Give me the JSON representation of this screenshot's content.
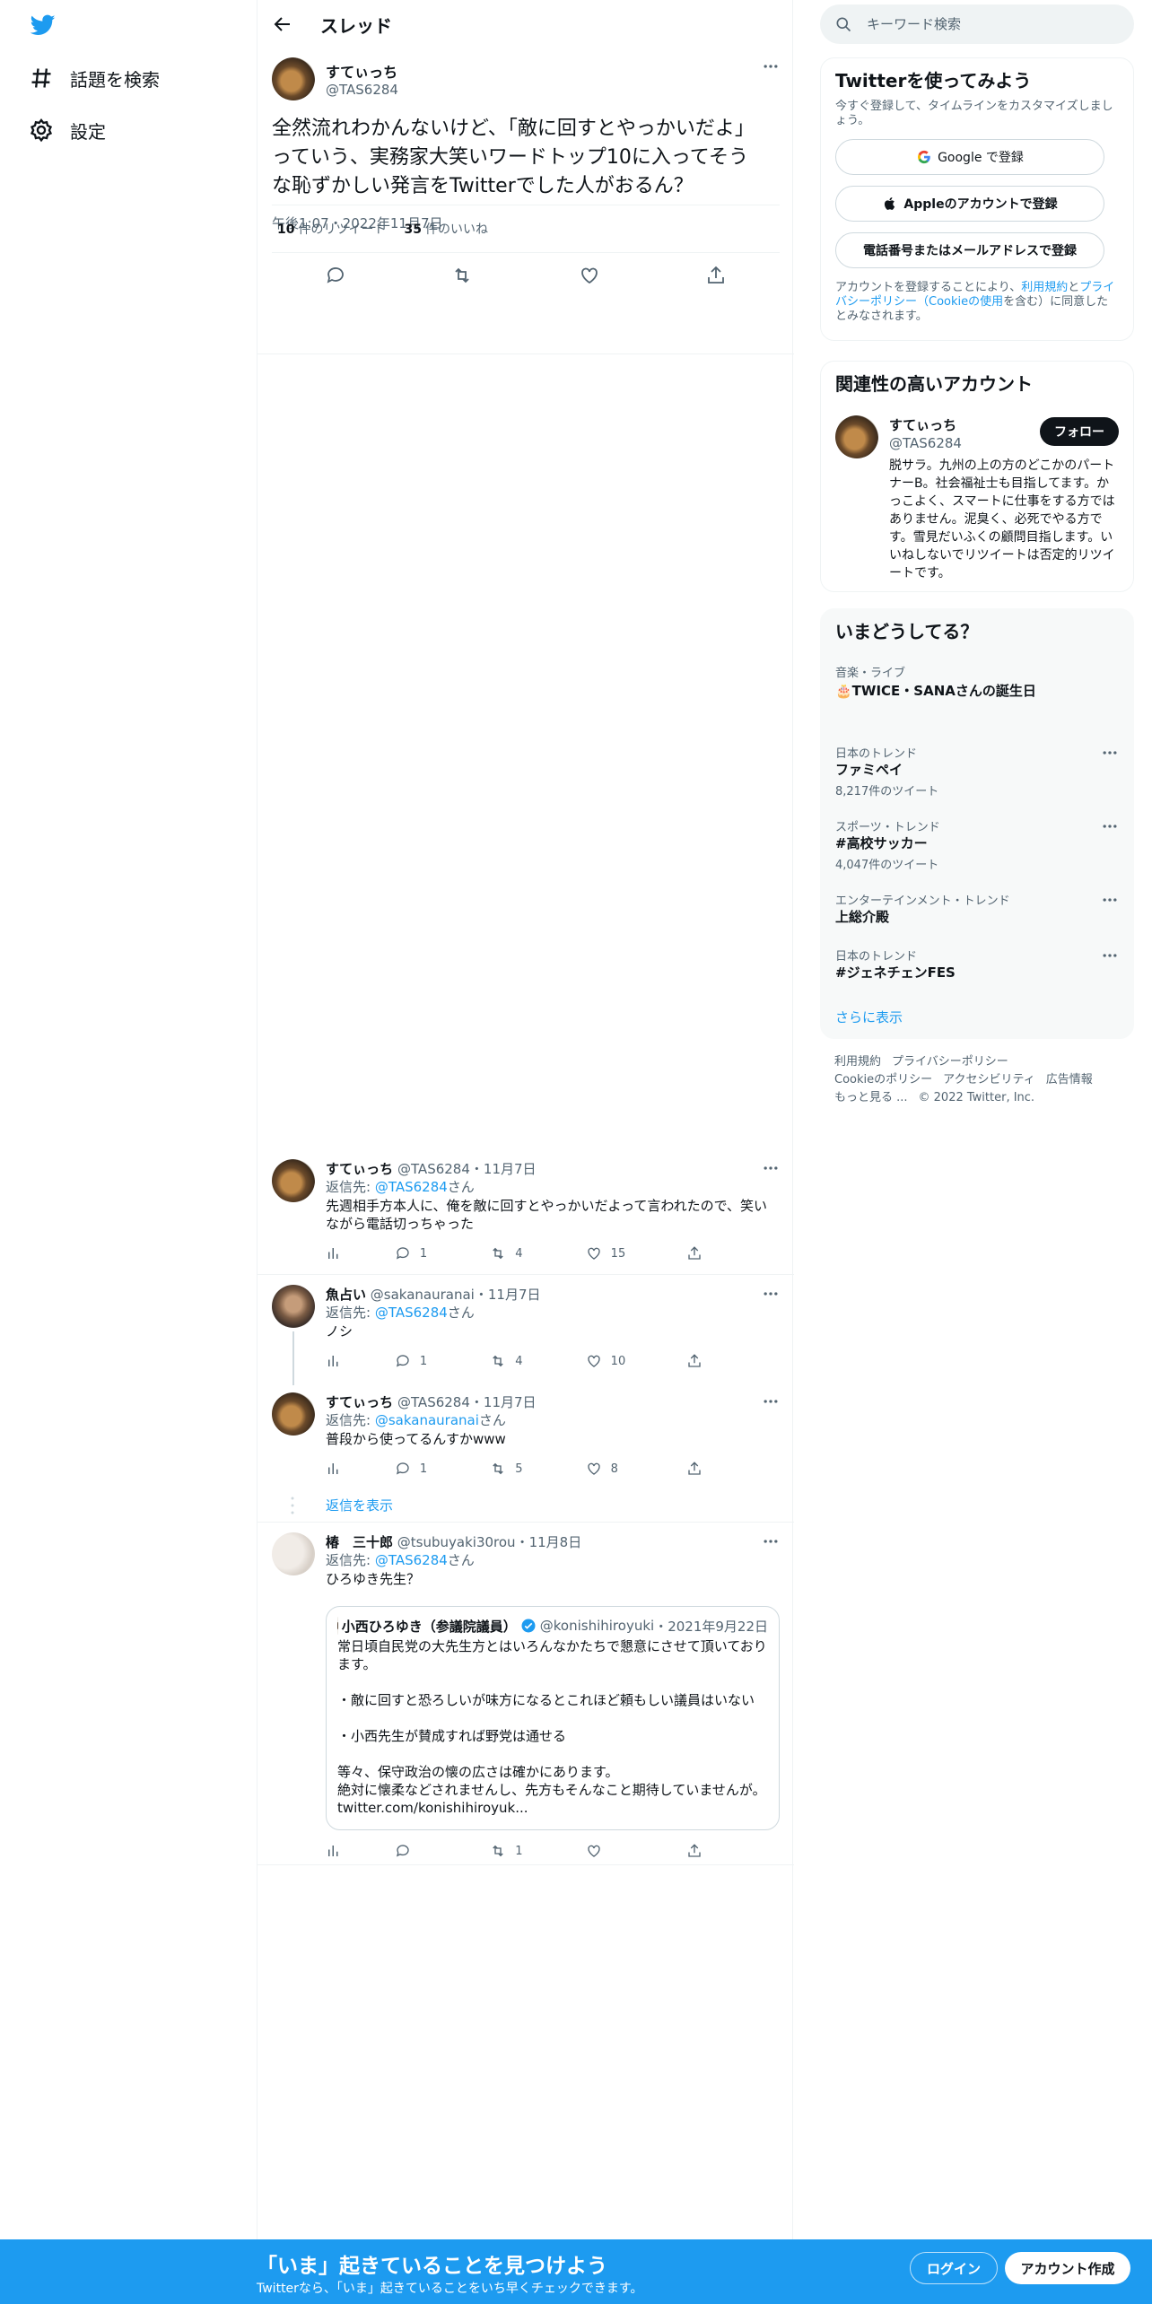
{
  "nav": {
    "explore_label": "話題を検索",
    "settings_label": "設定"
  },
  "header": {
    "title": "スレッド"
  },
  "main_tweet": {
    "name": "すてぃっち",
    "handle": "@TAS6284",
    "text": "全然流れわかんないけど、「敵に回すとやっかいだよ」っていう、実務家大笑いワードトップ10に入ってそうな恥ずかしい発言をTwitterでした人がおるん？",
    "time": "午後1:07・2022年11月7日",
    "retweets_count": "10",
    "retweets_label": "件のリツイート",
    "likes_count": "35",
    "likes_label": "件のいいね"
  },
  "replies": [
    {
      "name": "すてぃっち",
      "handle": "@TAS6284",
      "date": "・11月7日",
      "reply_to_prefix": "返信先: ",
      "reply_to": "@TAS6284",
      "reply_to_suffix": "さん",
      "text": "先週相手方本人に、俺を敵に回すとやっかいだよって言われたので、笑いながら電話切っちゃった",
      "replies": "1",
      "retweets": "4",
      "likes": "15"
    },
    {
      "name": "魚占い",
      "handle": "@sakanauranai",
      "date": "・11月7日",
      "reply_to_prefix": "返信先: ",
      "reply_to": "@TAS6284",
      "reply_to_suffix": "さん",
      "text": "ノシ",
      "replies": "1",
      "retweets": "4",
      "likes": "10"
    },
    {
      "name": "すてぃっち",
      "handle": "@TAS6284",
      "date": "・11月7日",
      "reply_to_prefix": "返信先: ",
      "reply_to": "@sakanauranai",
      "reply_to_suffix": "さん",
      "text": "普段から使ってるんすかwww",
      "replies": "1",
      "retweets": "5",
      "likes": "8"
    },
    {
      "name": "椿　三十郎",
      "handle": "@tsubuyaki30rou",
      "date": "・11月8日",
      "reply_to_prefix": "返信先: ",
      "reply_to": "@TAS6284",
      "reply_to_suffix": "さん",
      "text": "ひろゆき先生？",
      "replies": "",
      "retweets": "1",
      "likes": ""
    }
  ],
  "show_replies_label": "返信を表示",
  "quote": {
    "name": "小西ひろゆき（参議院議員）",
    "handle": "@konishihiroyuki",
    "date": "・2021年9月22日",
    "text": "常日頃自民党の大先生方とはいろんなかたちで懇意にさせて頂いております。\n\n・敵に回すと恐ろしいが味方になるとこれほど頼もしい議員はいない\n\n・小西先生が賛成すれば野党は通せる\n\n等々、保守政治の懐の広さは確かにあります。\n絶対に懐柔などされませんし、先方もそんなこと期待していませんが。\ntwitter.com/konishihiroyuk..."
  },
  "search": {
    "placeholder": "キーワード検索"
  },
  "signup_card": {
    "title": "Twitterを使ってみよう",
    "subtitle": "今すぐ登録して、タイムラインをカスタマイズしましょう。",
    "google_label": "Google で登録",
    "apple_label": "Appleのアカウントで登録",
    "phone_label": "電話番号またはメールアドレスで登録",
    "legal_prefix": "アカウントを登録することにより、",
    "legal_link1": "利用規約",
    "legal_and": "と",
    "legal_link2": "プライバシーポリシー（Cookieの使用",
    "legal_suffix": "を含む）に同意したとみなされます。"
  },
  "relevant": {
    "title": "関連性の高いアカウント",
    "name": "すてぃっち",
    "handle": "@TAS6284",
    "follow_label": "フォロー",
    "bio": "脱サラ。九州の上の方のどこかのパートナーB。社会福祉士も目指してます。かっこよく、スマートに仕事をする方ではありません。泥臭く、必死でやる方です。雪見だいふくの顧問目指します。いいねしないでリツイートは否定的リツイートです。"
  },
  "trends": {
    "title": "いまどうしてる？",
    "items": [
      {
        "category": "音楽・ライブ",
        "name": "🎂TWICE・SANAさんの誕生日",
        "count": ""
      },
      {
        "category": "日本のトレンド",
        "name": "ファミペイ",
        "count": "8,217件のツイート"
      },
      {
        "category": "スポーツ・トレンド",
        "name": "#高校サッカー",
        "count": "4,047件のツイート"
      },
      {
        "category": "エンターテインメント・トレンド",
        "name": "上総介殿",
        "count": ""
      },
      {
        "category": "日本のトレンド",
        "name": "#ジェネチェンFES",
        "count": ""
      }
    ],
    "show_more": "さらに表示"
  },
  "footer": {
    "terms": "利用規約",
    "privacy": "プライバシーポリシー",
    "cookie": "Cookieのポリシー",
    "accessibility": "アクセシビリティ",
    "ads": "広告情報",
    "more": "もっと見る ...",
    "copyright": "© 2022 Twitter, Inc."
  },
  "bottom_bar": {
    "title": "「いま」起きていることを見つけよう",
    "subtitle": "Twitterなら、「いま」起きていることをいち早くチェックできます。",
    "login_label": "ログイン",
    "signup_label": "アカウント作成"
  },
  "colors": {
    "accent": "#1d9bf0",
    "text": "#0f1419",
    "muted": "#536471",
    "border": "#eff3f4"
  }
}
